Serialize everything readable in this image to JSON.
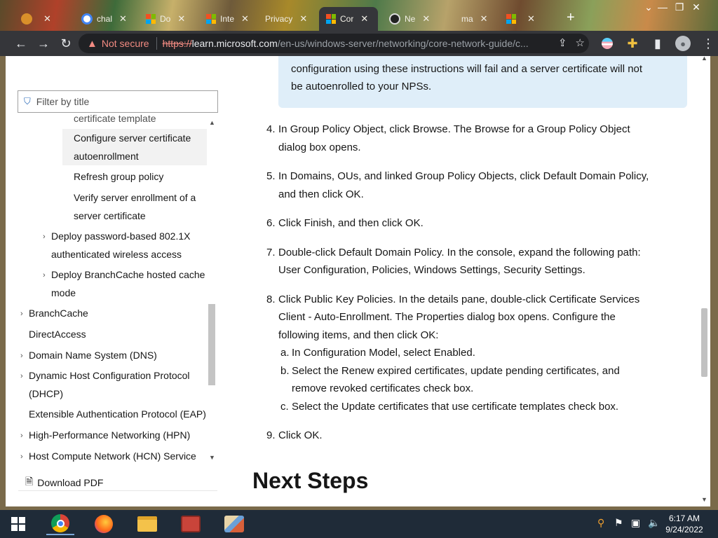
{
  "browser": {
    "tabs": [
      {
        "title": "",
        "favicon": "warning-icon",
        "active": false
      },
      {
        "title": "chal",
        "favicon": "google-icon",
        "active": false
      },
      {
        "title": "Do",
        "favicon": "microsoft-logo",
        "active": false
      },
      {
        "title": "Inte",
        "favicon": "microsoft-logo",
        "active": false
      },
      {
        "title": "Privacy",
        "favicon": "none",
        "active": false
      },
      {
        "title": "Cor",
        "favicon": "microsoft-logo",
        "active": true
      },
      {
        "title": "Ne",
        "favicon": "github-icon",
        "active": false
      },
      {
        "title": "ma",
        "favicon": "none",
        "active": false
      },
      {
        "title": "",
        "favicon": "microsoft-logo",
        "active": false
      }
    ],
    "security_label": "Not secure",
    "url_scheme": "https://",
    "url_host": "learn.microsoft.com",
    "url_path": "/en-us/windows-server/networking/core-network-guide/c..."
  },
  "sidebar": {
    "filter_placeholder": "Filter by title",
    "items": [
      {
        "label": "certificate template",
        "level": 3
      },
      {
        "label": "Configure server certificate autoenrollment",
        "level": 3,
        "selected": true
      },
      {
        "label": "Refresh group policy",
        "level": 3
      },
      {
        "label": "Verify server enrollment of a server certificate",
        "level": 3
      },
      {
        "label": "Deploy password-based 802.1X authenticated wireless access",
        "level": 2,
        "expandable": true
      },
      {
        "label": "Deploy BranchCache hosted cache mode",
        "level": 2,
        "expandable": true
      },
      {
        "label": "BranchCache",
        "level": 1,
        "expandable": true
      },
      {
        "label": "DirectAccess",
        "level": 1
      },
      {
        "label": "Domain Name System (DNS)",
        "level": 1,
        "expandable": true
      },
      {
        "label": "Dynamic Host Configuration Protocol (DHCP)",
        "level": 1,
        "expandable": true
      },
      {
        "label": "Extensible Authentication Protocol (EAP)",
        "level": 1
      },
      {
        "label": "High-Performance Networking (HPN)",
        "level": 1,
        "expandable": true
      },
      {
        "label": "Host Compute Network (HCN) Service",
        "level": 1,
        "expandable": true
      }
    ],
    "download_label": "Download PDF"
  },
  "article": {
    "note_line1": "configuration using these instructions will fail and a server certificate will not",
    "note_line2": "be autoenrolled to your NPSs.",
    "steps": {
      "s4": {
        "num": "4.",
        "t1": "In ",
        "b1": "Group Policy Object",
        "t2": ", click ",
        "b2": "Browse",
        "t3": ". The ",
        "b3": "Browse for a Group Policy Object",
        "t4": "dialog box opens."
      },
      "s5": {
        "num": "5.",
        "t1": "In ",
        "b1": "Domains, OUs, and linked Group Policy Objects,",
        "t2": " click ",
        "b2": "Default Domain Policy",
        "t3": ",",
        "t4": "and then click ",
        "b3": "OK",
        "t5": "."
      },
      "s6": {
        "num": "6.",
        "t1": "Click ",
        "b1": "Finish",
        "t2": ", and then click ",
        "b2": "OK",
        "t3": "."
      },
      "s7": {
        "num": "7.",
        "t1": "Double-click ",
        "b1": "Default Domain Policy",
        "t2": ". In the console, expand the following path:",
        "b2": "User Configuration",
        "t3": ", ",
        "b3": "Policies",
        "t4": ", ",
        "b4": "Windows Settings",
        "t5": ", ",
        "b5": "Security Settings",
        "t6": "."
      },
      "s8": {
        "num": "8.",
        "t1": "Click ",
        "b1": "Public Key Policies",
        "t2": ". In the details pane, double-click ",
        "b2": "Certificate Services",
        "b3": "Client - Auto-Enrollment",
        "t3": ". The ",
        "b4": "Properties",
        "t4": " dialog box opens. Configure the",
        "t5": "following items, and then click ",
        "b5": "OK",
        "t6": ":",
        "a": {
          "num": "a.",
          "t1": "In ",
          "b1": "Configuration Model",
          "t2": ", select ",
          "b2": "Enabled",
          "t3": "."
        },
        "b": {
          "num": "b.",
          "t1": "Select the ",
          "b1": "Renew expired certificates, update pending certificates, and",
          "b2": "remove revoked certificates",
          "t2": " check box."
        },
        "c": {
          "num": "c.",
          "t1": "Select the ",
          "b1": "Update certificates that use certificate templates",
          "t2": " check box."
        }
      },
      "s9": {
        "num": "9.",
        "t1": "Click ",
        "b1": "OK",
        "t2": "."
      }
    },
    "next_steps_heading": "Next Steps"
  },
  "taskbar": {
    "apps": [
      "windows-start-icon",
      "chrome-icon",
      "firefox-icon",
      "file-explorer-icon",
      "toolbox-icon",
      "paint-icon"
    ],
    "clock_time": "6:17 AM",
    "clock_date": "9/24/2022"
  }
}
